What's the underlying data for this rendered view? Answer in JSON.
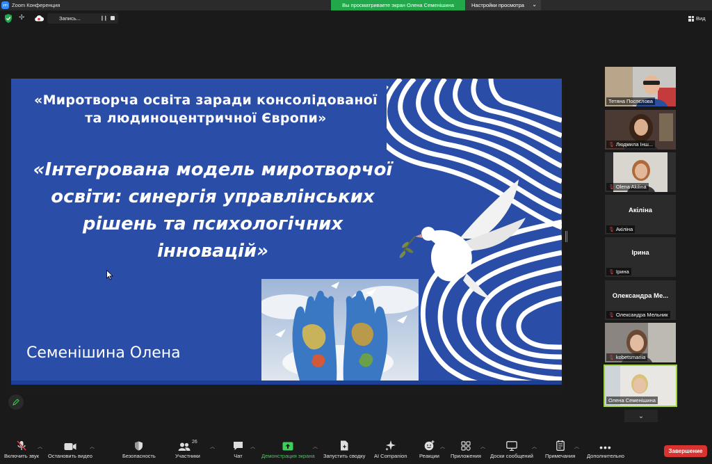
{
  "window": {
    "app_title": "Zoom Конференция",
    "logo_text": "zm"
  },
  "share_banner": {
    "text": "Вы просматриваете экран Олена Семенішина",
    "settings_label": "Настройки просмотра",
    "settings_chevron": "⌄"
  },
  "topbar": {
    "record_label": "Запись...",
    "view_label": "Вид"
  },
  "slide": {
    "subtitle": "«Миротворча освіта заради консолідованої та людиноцентричної Європи»",
    "title": "«Інтегрована модель миротворчої освіти: синергія управлінських рішень та психологічних інновацій»",
    "author": "Семенішина Олена",
    "colors": {
      "background": "#2a4ea8",
      "wave": "#ffffff"
    }
  },
  "participants": [
    {
      "name": "Тетяна Поспєлова",
      "muted": false,
      "video": true
    },
    {
      "name": "Людмила Інш...",
      "muted": true,
      "video": true
    },
    {
      "name": "Olena Akilina",
      "muted": true,
      "video": true
    },
    {
      "name": "Акіліна",
      "display": "Акіліна",
      "muted": true,
      "video": false
    },
    {
      "name": "Ірина",
      "display": "Ірина",
      "muted": true,
      "video": false
    },
    {
      "name": "Олександра Мельник",
      "display": "Олександра Ме...",
      "muted": true,
      "video": false
    },
    {
      "name": "kobetsmariia",
      "muted": true,
      "video": true
    },
    {
      "name": "Олена Семенішина",
      "muted": false,
      "video": true,
      "active": true
    }
  ],
  "toolbar": {
    "mute": "Включить звук",
    "video": "Остановить видео",
    "security": "Безопасность",
    "participants": "Участники",
    "participants_count": "26",
    "chat": "Чат",
    "share": "Демонстрация экрана",
    "summary": "Запустить сводку",
    "ai": "AI Companion",
    "reactions": "Реакции",
    "apps": "Приложения",
    "whiteboards": "Доски сообщений",
    "notes": "Примечания",
    "more": "Дополнительно",
    "end": "Завершение",
    "accent_green": "#3ecf5a",
    "end_color": "#d9332f"
  }
}
